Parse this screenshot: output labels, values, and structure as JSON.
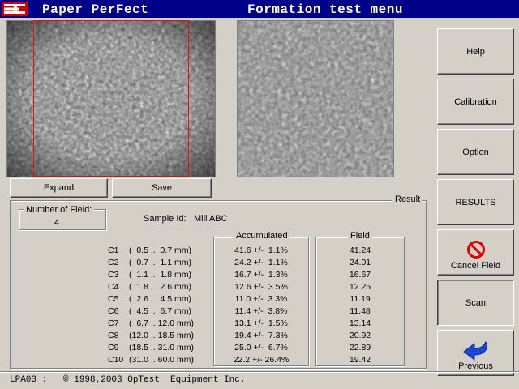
{
  "titlebar": {
    "app_name": "Paper PerFect",
    "menu_title": "Formation test menu"
  },
  "image_buttons": {
    "expand": "Expand",
    "save": "Save"
  },
  "side_buttons": {
    "help": "Help",
    "calibration": "Calibration",
    "option": "Option",
    "results": "RESULTS",
    "cancel_field": "Cancel Field",
    "scan": "Scan",
    "previous": "Previous"
  },
  "result": {
    "group_label": "Result",
    "number_of_field_label": "Number of Field:",
    "number_of_field_value": "4",
    "sample_id_label": "Sample Id:",
    "sample_id_value": "Mill ABC",
    "accumulated_label": "Accumulated",
    "field_label": "Field",
    "rows": [
      {
        "cls": "C1",
        "range": "(  0.5 ..  0.7 mm)",
        "accumulated": "41.6 +/-  1.1%",
        "field": "41.24"
      },
      {
        "cls": "C2",
        "range": "(  0.7 ..  1.1 mm)",
        "accumulated": "24.2 +/-  1.1%",
        "field": "24.01"
      },
      {
        "cls": "C3",
        "range": "(  1.1 ..  1.8 mm)",
        "accumulated": "16.7 +/-  1.3%",
        "field": "16.67"
      },
      {
        "cls": "C4",
        "range": "(  1.8 ..  2.6 mm)",
        "accumulated": "12.6 +/-  3.5%",
        "field": "12.25"
      },
      {
        "cls": "C5",
        "range": "(  2.6 ..  4.5 mm)",
        "accumulated": "11.0 +/-  3.3%",
        "field": "11.19"
      },
      {
        "cls": "C6",
        "range": "(  4.5 ..  6.7 mm)",
        "accumulated": "11.4 +/-  3.8%",
        "field": "11.48"
      },
      {
        "cls": "C7",
        "range": "(  6.7 .. 12.0 mm)",
        "accumulated": "13.1 +/-  1.5%",
        "field": "13.14"
      },
      {
        "cls": "C8",
        "range": "(12.0 .. 18.5 mm)",
        "accumulated": "19.4 +/-  7.3%",
        "field": "20.92"
      },
      {
        "cls": "C9",
        "range": "(18.5 .. 31.0 mm)",
        "accumulated": "25.0 +/-  6.7%",
        "field": "22.89"
      },
      {
        "cls": "C10",
        "range": "(31.0 .. 60.0 mm)",
        "accumulated": "22.2 +/- 26.4%",
        "field": "19.42"
      }
    ]
  },
  "status_bar": {
    "text": "LPA03 :   © 1998,2003 OpTest  Equipment Inc."
  },
  "colors": {
    "titlebar": "#000088",
    "selection": "#e01010",
    "cancel_icon": "#e00000",
    "previous_icon": "#1848d8"
  },
  "icons": {
    "logo": "optest-logo-icon",
    "cancel": "no-entry-icon",
    "previous": "back-arrow-icon"
  }
}
